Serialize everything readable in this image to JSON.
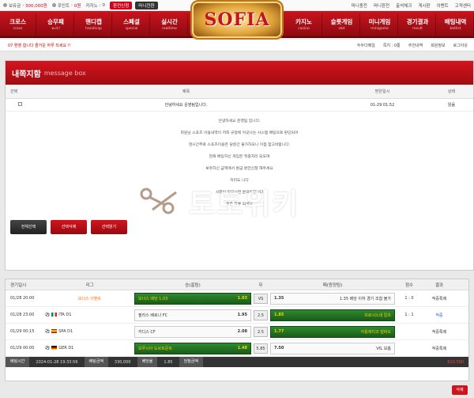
{
  "topbar": {
    "money_label": "보유금",
    "money_value": "300,000원",
    "point_label": "포인트",
    "point_value": "0원",
    "casino_label": "카지노",
    "casino_value": "0",
    "btn_exchange": "환전신청",
    "btn_mini": "머니전환",
    "links": [
      "머니충전",
      "머니환전",
      "출석체크",
      "게시판",
      "이벤트",
      "고객센터"
    ]
  },
  "logo": "SOFIA",
  "nav_left": [
    {
      "ko": "크로스",
      "en": "cross"
    },
    {
      "ko": "승무패",
      "en": "w.d.l"
    },
    {
      "ko": "핸디캡",
      "en": "handicap"
    },
    {
      "ko": "스페셜",
      "en": "special"
    },
    {
      "ko": "실시간",
      "en": "realtime"
    }
  ],
  "nav_right": [
    {
      "ko": "카지노",
      "en": "casino"
    },
    {
      "ko": "슬롯게임",
      "en": "slot"
    },
    {
      "ko": "미니게임",
      "en": "minigame"
    },
    {
      "ko": "경기결과",
      "en": "result"
    },
    {
      "ko": "배팅내역",
      "en": "betlist"
    }
  ],
  "subbar": {
    "notice": "07 환영 합니다 즐거운 하루 되세요 !!",
    "right": [
      "두두다메일",
      "쪽지 : 0통",
      "추천내역",
      "회원정보",
      "로그아웃"
    ]
  },
  "messagebox": {
    "title": "내쪽지함",
    "subtitle": "message box",
    "columns": [
      "선택",
      "제목",
      "받은일시",
      "상태"
    ],
    "row": {
      "title": "안녕하세요 운영팀입니다.",
      "date": "01-29 01:52",
      "status": "읽음"
    },
    "body_lines": [
      "안녕하세요 운영팀 입니다.",
      "회원님 스포츠 이용내역이 저희 규정에 어긋나는 시스템 배팅으로 판단되어",
      "현시간부로 스포츠이용은 당분간 불가하오니 이점 참고바랍니다.",
      "현재 배팅하신 게임은 적중처리 되오며",
      "보유하신 금액에서 환급 환전신청 해주세요",
      "처리도 니다",
      "사항이 있으시면 문의바랍니다",
      "좋은 하루 되세요"
    ],
    "buttons": [
      "전체선택",
      "선택삭제",
      "선택읽기"
    ]
  },
  "watermark": "토토위키",
  "betlist": {
    "columns": [
      "경기일시",
      "리그",
      "승(홈팀)",
      "무",
      "패(원정팀)",
      "점수",
      "결과"
    ],
    "rows": [
      {
        "date": "01/28 20:00",
        "league": "보너스 이벤트",
        "home": "보너스 배당 1.03",
        "home_odds": "1.03",
        "draw": "VS",
        "away": "1.35 배당 이하 경기 조합 불가",
        "away_odds": "1.35",
        "score": "1 : 0",
        "result": "적중특례"
      },
      {
        "date": "01/28 23:00",
        "league": "ITA D1",
        "home": "필라스 베로나 FC",
        "home_odds": "1.95",
        "draw": "2.5",
        "away": "프로시노네 칼초",
        "away_odds": "1.85",
        "score": "1 : 1",
        "result": "적중"
      },
      {
        "date": "01/29 00:15",
        "league": "SPA D1",
        "home": "카디스 CF",
        "home_odds": "2.08",
        "draw": "2.5",
        "away": "아틀레티코 빌바오",
        "away_odds": "1.77",
        "score": "",
        "result": "적중특례"
      },
      {
        "date": "01/29 00:00",
        "league": "GER D1",
        "home": "보루시아 도르트문트",
        "home_odds": "1.48",
        "draw": "5.85",
        "away": "VfL 보훔",
        "away_odds": "7.50",
        "score": "",
        "result": "적중특례"
      }
    ],
    "summary": {
      "time_label": "배팅시간",
      "time_value": "2024-01-28 19:33:56",
      "amount_label": "배팅금액",
      "amount_value": "330,000",
      "odds_label": "배당율",
      "odds_value": "1.85",
      "win_label": "당첨금액",
      "win_value": "610,500"
    },
    "delete_btn": "삭제"
  }
}
